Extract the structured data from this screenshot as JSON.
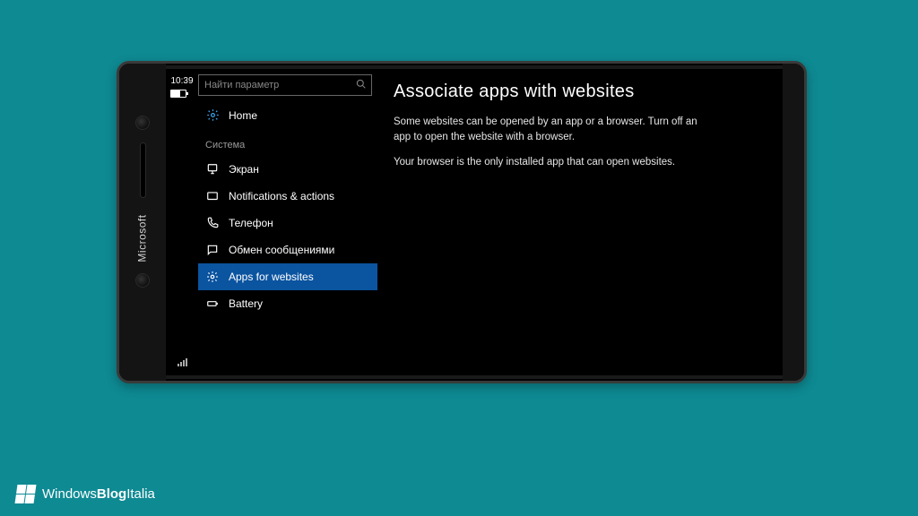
{
  "status": {
    "time": "10:39"
  },
  "device": {
    "brand": "Microsoft"
  },
  "sidebar": {
    "search_placeholder": "Найти параметр",
    "home_label": "Home",
    "section_label": "Система",
    "items": [
      {
        "label": "Экран",
        "icon": "monitor-icon"
      },
      {
        "label": "Notifications & actions",
        "icon": "message-icon"
      },
      {
        "label": "Телефон",
        "icon": "phone-icon"
      },
      {
        "label": "Обмен сообщениями",
        "icon": "chat-icon"
      },
      {
        "label": "Apps for websites",
        "icon": "gear-icon",
        "selected": true
      },
      {
        "label": "Battery",
        "icon": "battery-icon",
        "partial": true
      }
    ]
  },
  "content": {
    "title": "Associate apps with websites",
    "paragraph1": "Some websites can be opened by an app or a browser.  Turn off an app to open the website with a browser.",
    "paragraph2": "Your browser is the only installed app that can open websites."
  },
  "watermark": {
    "text_pre": "Windows",
    "text_bold": "Blog",
    "text_post": "Italia"
  },
  "icons": {
    "gear": "⚙",
    "monitor": "▢",
    "message": "✉",
    "phone": "✆",
    "chat": "☐",
    "battery": "▭",
    "search": "⌕"
  }
}
